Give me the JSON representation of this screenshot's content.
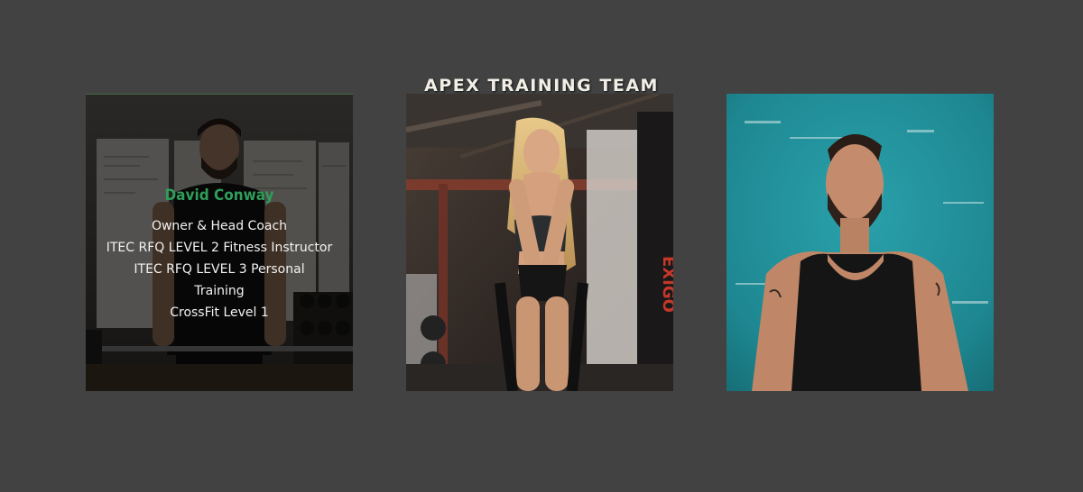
{
  "section": {
    "title": "APEX TRAINING TEAM"
  },
  "team": [
    {
      "name": "David Conway",
      "credentials": [
        "Owner & Head Coach",
        "ITEC RFQ LEVEL 2 Fitness Instructor",
        "ITEC RFQ LEVEL 3 Personal",
        "Training",
        "CrossFit Level 1"
      ],
      "photo": "man-with-barbell-in-gym-photo"
    },
    {
      "photo": "woman-with-battle-ropes-photo"
    },
    {
      "photo": "man-in-black-tank-top-teal-wall-photo"
    }
  ],
  "colors": {
    "background": "#424242",
    "name_accent": "#2f9e5a",
    "teal_wall": "#1f8a95"
  }
}
